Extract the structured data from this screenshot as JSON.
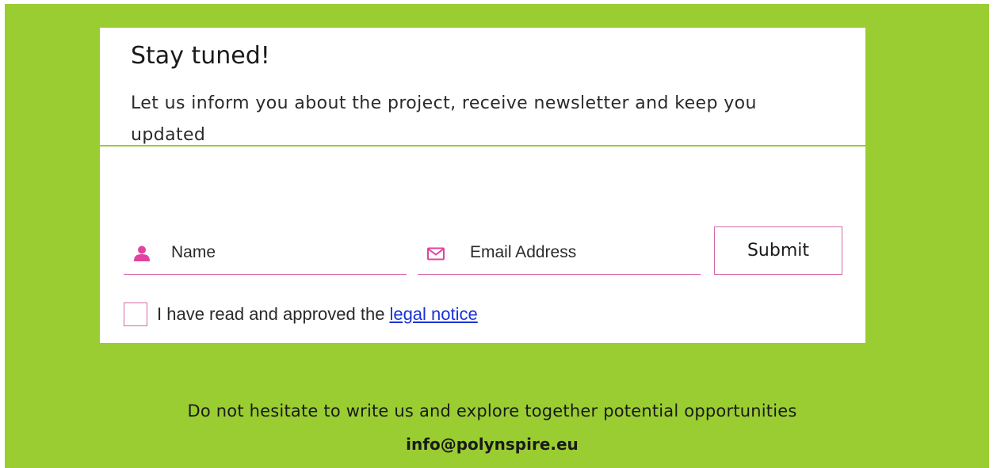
{
  "newsletter": {
    "title": "Stay tuned!",
    "subtitle": "Let us inform you about the project, receive newsletter and keep you updated",
    "name_field": {
      "placeholder": "Name",
      "value": "",
      "icon": "user-icon"
    },
    "email_field": {
      "placeholder": "Email Address",
      "value": "",
      "icon": "envelope-icon"
    },
    "submit_label": "Submit",
    "consent": {
      "checked": false,
      "text": "I have read and approved the",
      "link_label": "legal notice"
    }
  },
  "footer": {
    "cta_text": "Do not hesitate to write us and explore together potential opportunities",
    "email": "info@polynspire.eu"
  },
  "colors": {
    "background": "#9acd32",
    "card": "#ffffff",
    "accent": "#d667a8",
    "link": "#1a33d6"
  }
}
